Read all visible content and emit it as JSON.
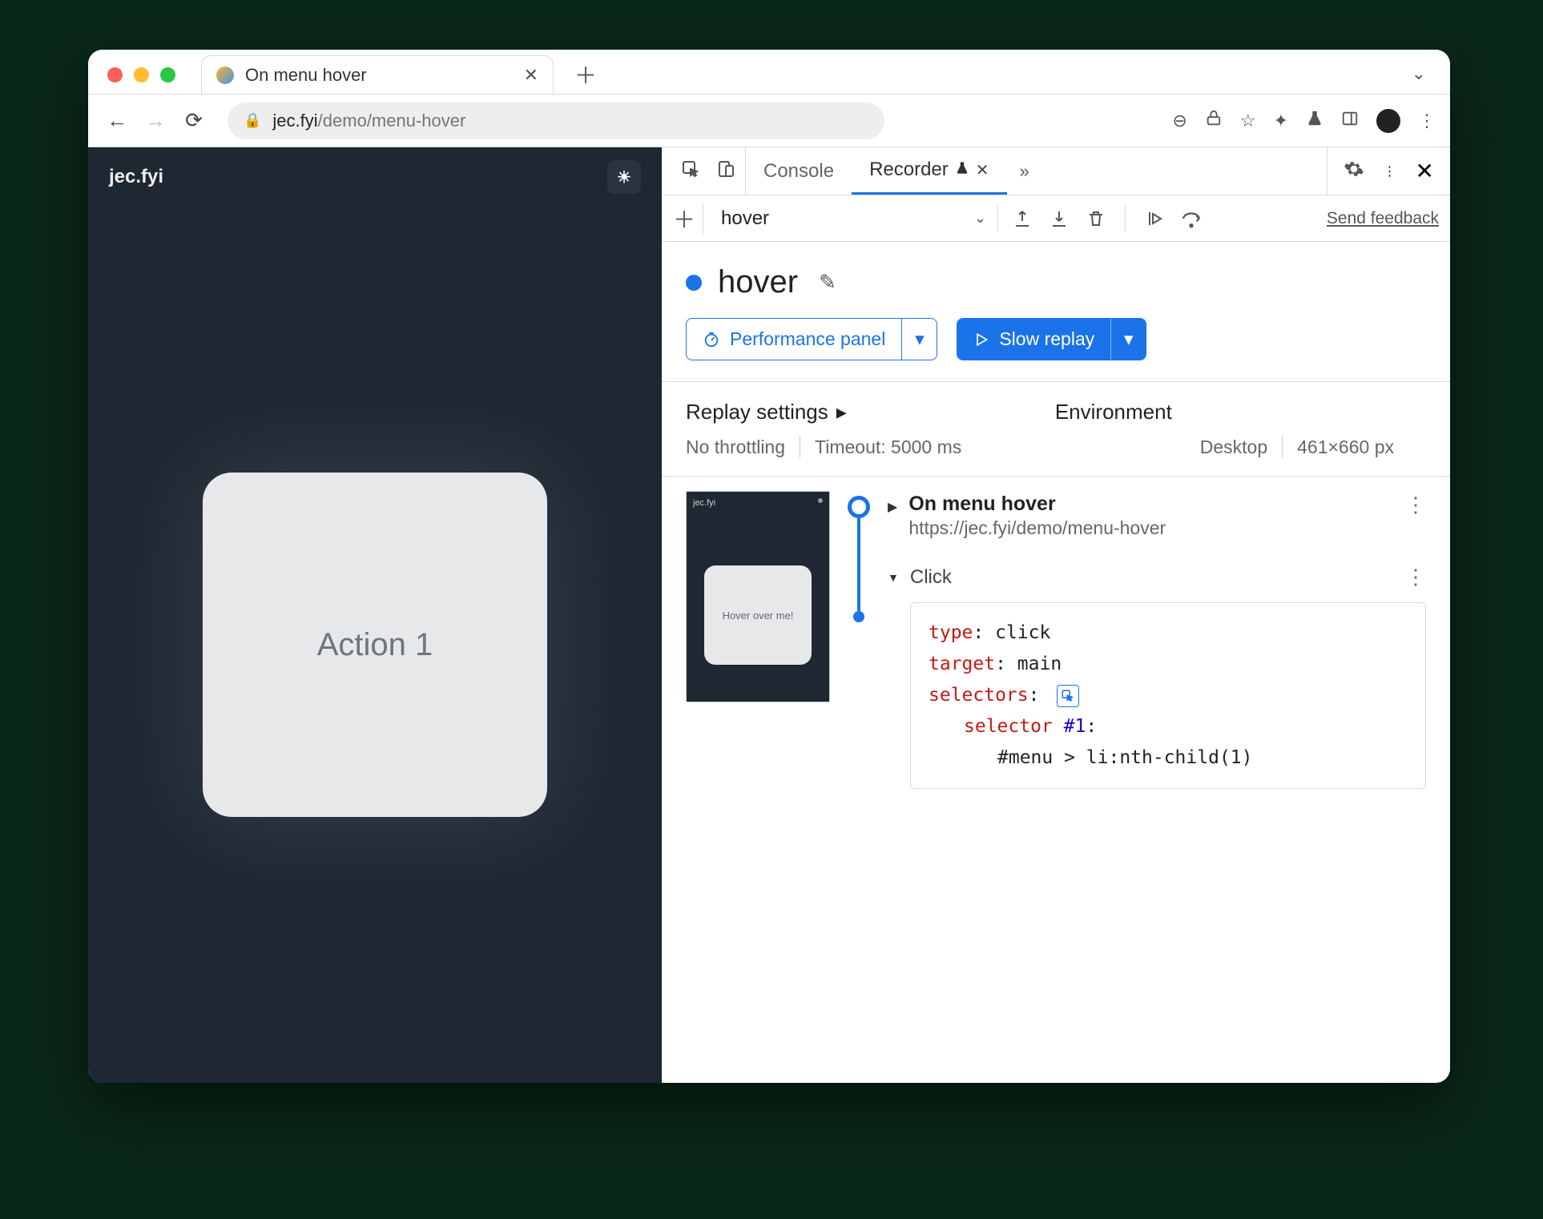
{
  "browser": {
    "tab_title": "On menu hover",
    "url_host": "jec.fyi",
    "url_path": "/demo/menu-hover"
  },
  "page": {
    "brand": "jec.fyi",
    "card_label": "Action 1"
  },
  "devtools": {
    "tabs": {
      "console": "Console",
      "recorder": "Recorder"
    },
    "toolbar": {
      "recording_select": "hover",
      "feedback": "Send feedback"
    },
    "recording": {
      "name": "hover",
      "perf_button": "Performance panel",
      "replay_button": "Slow replay"
    },
    "settings": {
      "replay_title": "Replay settings",
      "env_title": "Environment",
      "throttle": "No throttling",
      "timeout": "Timeout: 5000 ms",
      "env_device": "Desktop",
      "env_size": "461×660 px"
    },
    "steps": {
      "nav": {
        "title": "On menu hover",
        "url": "https://jec.fyi/demo/menu-hover"
      },
      "click": {
        "label": "Click",
        "type_key": "type",
        "type_val": "click",
        "target_key": "target",
        "target_val": "main",
        "selectors_key": "selectors",
        "selector_label": "selector",
        "selector_index": "#1",
        "selector_value": "#menu > li:nth-child(1)"
      }
    },
    "thumb": {
      "brand": "jec.fyi",
      "label": "Hover over me!"
    }
  }
}
